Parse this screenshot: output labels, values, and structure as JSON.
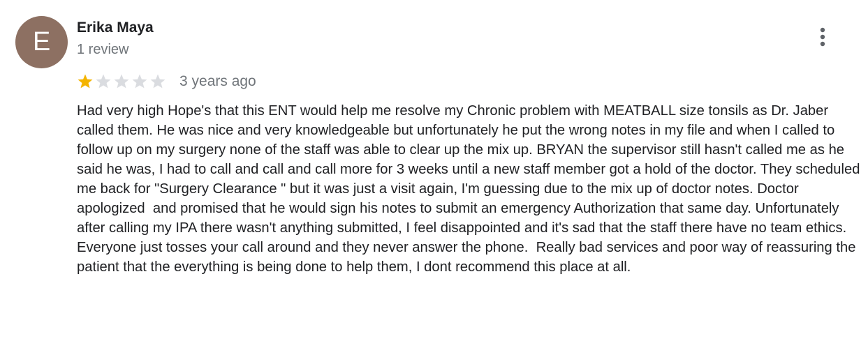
{
  "review": {
    "author": {
      "initial": "E",
      "name": "Erika Maya",
      "review_count": "1 review",
      "avatar_color": "#8d7062"
    },
    "rating": {
      "value": 1,
      "max": 5,
      "filled_color": "#f4b400",
      "empty_color": "#dadce0"
    },
    "date": "3 years ago",
    "text": "Had very high Hope's that this ENT would help me resolve my Chronic problem with MEATBALL size tonsils as Dr. Jaber called them. He was nice and very knowledgeable but unfortunately he put the wrong notes in my file and when I called to follow up on my surgery none of the staff was able to clear up the mix up. BRYAN the supervisor still hasn't called me as he said he was, I had to call and call and call more for 3 weeks until a new staff member got a hold of the doctor. They scheduled  me back for \"Surgery Clearance \" but it was just a visit again, I'm guessing due to the mix up of doctor notes. Doctor apologized  and promised that he would sign his notes to submit an emergency Authorization that same day. Unfortunately after calling my IPA there wasn't anything submitted, I feel disappointed and it's sad that the staff there have no team ethics. Everyone just tosses your call around and they never answer the phone.  Really bad services and poor way of reassuring the patient that the everything is being done to help them, I dont recommend this place at all.",
    "menu_icon": "more-vert-icon"
  }
}
